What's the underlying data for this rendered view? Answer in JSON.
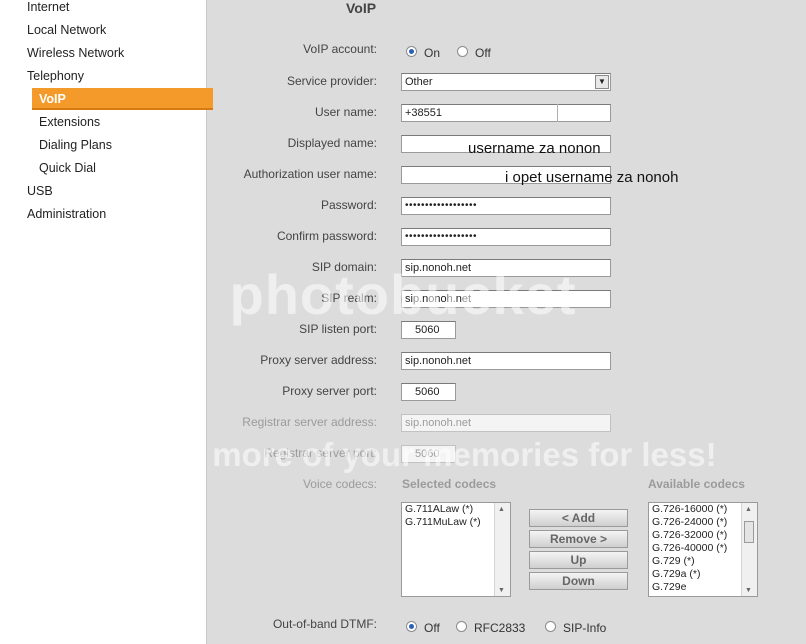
{
  "sidebar": {
    "items": [
      {
        "label": "Internet"
      },
      {
        "label": "Local Network"
      },
      {
        "label": "Wireless Network"
      },
      {
        "label": "Telephony"
      },
      {
        "label": "VoIP"
      },
      {
        "label": "Extensions"
      },
      {
        "label": "Dialing Plans"
      },
      {
        "label": "Quick Dial"
      },
      {
        "label": "USB"
      },
      {
        "label": "Administration"
      }
    ],
    "active_item": "VoIP"
  },
  "page": {
    "title": "VoIP"
  },
  "form": {
    "voip_account": {
      "label": "VoIP account:",
      "on_label": "On",
      "off_label": "Off",
      "selected": "On"
    },
    "service_provider": {
      "label": "Service provider:",
      "value": "Other"
    },
    "user_name": {
      "label": "User name:",
      "value": "+38551"
    },
    "displayed_name": {
      "label": "Displayed name:",
      "value": ""
    },
    "auth_user_name": {
      "label": "Authorization user name:",
      "value": ""
    },
    "password": {
      "label": "Password:",
      "value": "••••••••••••••••••"
    },
    "confirm_password": {
      "label": "Confirm password:",
      "value": "••••••••••••••••••"
    },
    "sip_domain": {
      "label": "SIP domain:",
      "value": "sip.nonoh.net"
    },
    "sip_realm": {
      "label": "SIP realm:",
      "value": "sip.nonoh.net"
    },
    "sip_listen_port": {
      "label": "SIP listen port:",
      "value": "5060"
    },
    "proxy_server_address": {
      "label": "Proxy server address:",
      "value": "sip.nonoh.net"
    },
    "proxy_server_port": {
      "label": "Proxy server port:",
      "value": "5060"
    },
    "registrar_server_address": {
      "label": "Registrar server address:",
      "value": "sip.nonoh.net"
    },
    "registrar_server_port": {
      "label": "Registrar server port:",
      "value": "5060"
    },
    "voice_codecs": {
      "label": "Voice codecs:",
      "selected_heading": "Selected codecs",
      "available_heading": "Available codecs",
      "selected": [
        "G.711ALaw (*)",
        "G.711MuLaw (*)"
      ],
      "available": [
        "G.726-16000 (*)",
        "G.726-24000 (*)",
        "G.726-32000 (*)",
        "G.726-40000 (*)",
        "G.729 (*)",
        "G.729a (*)",
        "G.729e"
      ],
      "buttons": {
        "add": "< Add",
        "remove": "Remove >",
        "up": "Up",
        "down": "Down"
      }
    },
    "dtmf": {
      "label": "Out-of-band DTMF:",
      "options": [
        "Off",
        "RFC2833",
        "SIP-Info"
      ],
      "selected": "Off"
    }
  },
  "annotations": {
    "note1": "username za nonon",
    "note2": "i opet username za nonoh"
  },
  "watermark": {
    "brand": "photobucket",
    "tagline": "Protect more of your memories for less!"
  },
  "colors": {
    "accent": "#f39a2a",
    "background": "#dcdcdc",
    "radio_dot": "#2d5fb8"
  }
}
